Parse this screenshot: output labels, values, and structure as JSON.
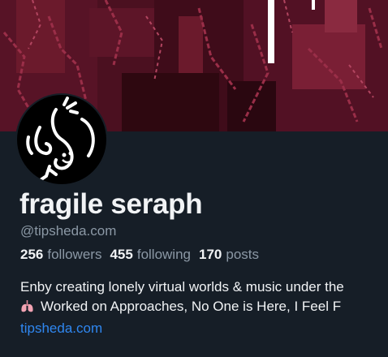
{
  "profile": {
    "display_name": "fragile seraph",
    "handle": "@tipsheda.com",
    "avatar_icon": "squiggle-creature-avatar",
    "banner_icon": "pixel-art-red-figure-banner"
  },
  "stats": {
    "followers_count": "256",
    "followers_label": "followers",
    "following_count": "455",
    "following_label": "following",
    "posts_count": "170",
    "posts_label": "posts"
  },
  "bio": {
    "line1": "Enby creating lonely virtual worlds & music under the",
    "emoji_icon": "lungs-emoji",
    "line2": "Worked on Approaches, No One is Here, I Feel F",
    "link": "tipsheda.com"
  },
  "colors": {
    "background": "#161e27",
    "accent_link": "#2f87f0",
    "muted_text": "#8b98a5",
    "banner_red": "#7a1a30"
  }
}
